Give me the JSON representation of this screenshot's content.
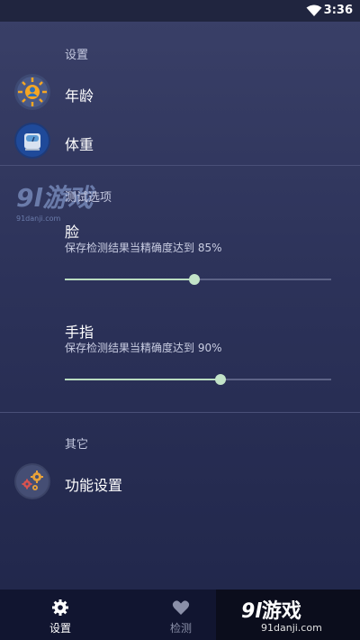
{
  "status_bar": {
    "time": "3:36"
  },
  "sections": {
    "settings_header": "设置",
    "test_header": "测试选项",
    "other_header": "其它"
  },
  "rows": {
    "age": "年龄",
    "weight": "体重",
    "feature_settings": "功能设置"
  },
  "face": {
    "title": "脸",
    "subtitle": "保存检测结果当精确度达到 85%",
    "accuracy_percent": 85
  },
  "finger": {
    "title": "手指",
    "subtitle": "保存检测结果当精确度达到 90%",
    "accuracy_percent": 90
  },
  "bottom_nav": {
    "settings_label": "设置",
    "detect_label": "检测"
  },
  "watermark": {
    "logo": "91游戏",
    "url": "91danji.com"
  },
  "colors": {
    "accent": "#c2e3c8",
    "background_top": "#3a4068",
    "background_bottom": "#20264a"
  },
  "icons": [
    "wifi-icon",
    "age-sun-icon",
    "weight-scale-icon",
    "gears-icon",
    "gear-icon",
    "heart-icon"
  ]
}
